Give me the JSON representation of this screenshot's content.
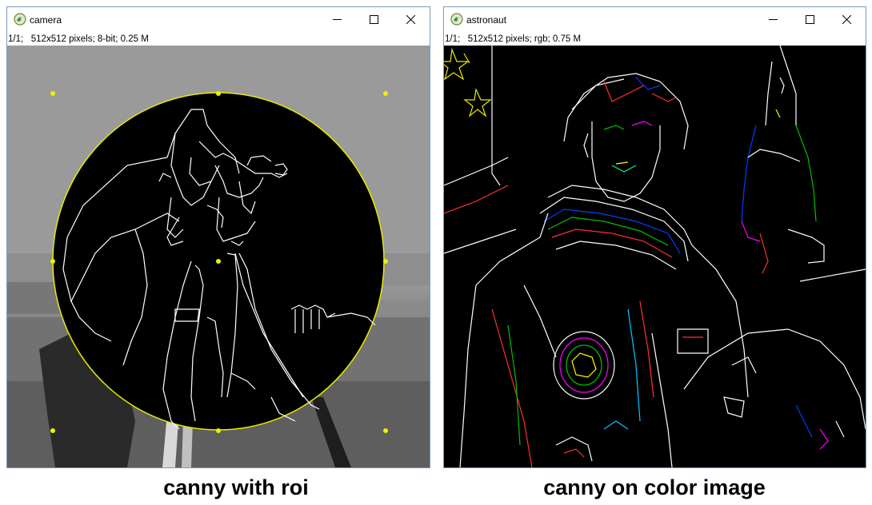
{
  "windows": [
    {
      "title": "camera",
      "info": "1/1;   512x512 pixels; 8-bit; 0.25 M",
      "caption": "canny with roi"
    },
    {
      "title": "astronaut",
      "info": "1/1;   512x512 pixels; rgb; 0.75 M",
      "caption": "canny on color image"
    }
  ],
  "colors": {
    "roi_outline": "#e8e800",
    "handle": "#f0f000",
    "edge_white": "#ffffff",
    "titlebar_text": "#000000"
  },
  "icons": {
    "app": "app-logo-icon",
    "minimize": "minimize-icon",
    "maximize": "maximize-icon",
    "close": "close-icon"
  }
}
